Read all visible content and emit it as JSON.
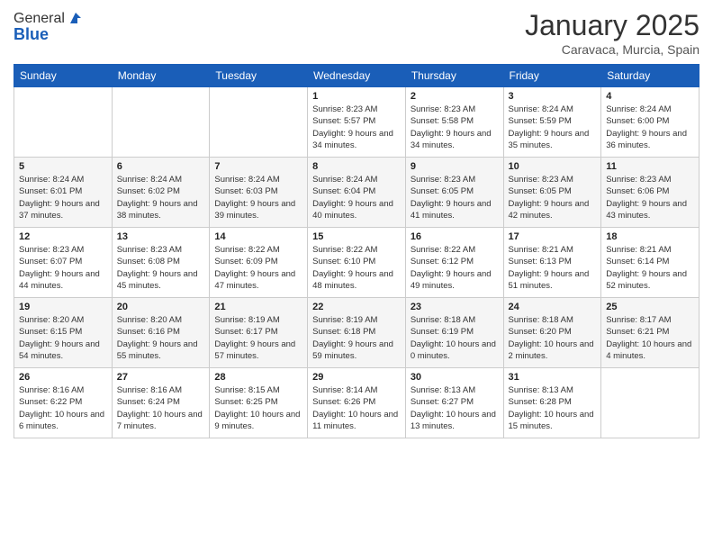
{
  "logo": {
    "general": "General",
    "blue": "Blue"
  },
  "title": "January 2025",
  "location": "Caravaca, Murcia, Spain",
  "days_of_week": [
    "Sunday",
    "Monday",
    "Tuesday",
    "Wednesday",
    "Thursday",
    "Friday",
    "Saturday"
  ],
  "weeks": [
    [
      {
        "day": "",
        "info": ""
      },
      {
        "day": "",
        "info": ""
      },
      {
        "day": "",
        "info": ""
      },
      {
        "day": "1",
        "sunrise": "Sunrise: 8:23 AM",
        "sunset": "Sunset: 5:57 PM",
        "daylight": "Daylight: 9 hours and 34 minutes."
      },
      {
        "day": "2",
        "sunrise": "Sunrise: 8:23 AM",
        "sunset": "Sunset: 5:58 PM",
        "daylight": "Daylight: 9 hours and 34 minutes."
      },
      {
        "day": "3",
        "sunrise": "Sunrise: 8:24 AM",
        "sunset": "Sunset: 5:59 PM",
        "daylight": "Daylight: 9 hours and 35 minutes."
      },
      {
        "day": "4",
        "sunrise": "Sunrise: 8:24 AM",
        "sunset": "Sunset: 6:00 PM",
        "daylight": "Daylight: 9 hours and 36 minutes."
      }
    ],
    [
      {
        "day": "5",
        "sunrise": "Sunrise: 8:24 AM",
        "sunset": "Sunset: 6:01 PM",
        "daylight": "Daylight: 9 hours and 37 minutes."
      },
      {
        "day": "6",
        "sunrise": "Sunrise: 8:24 AM",
        "sunset": "Sunset: 6:02 PM",
        "daylight": "Daylight: 9 hours and 38 minutes."
      },
      {
        "day": "7",
        "sunrise": "Sunrise: 8:24 AM",
        "sunset": "Sunset: 6:03 PM",
        "daylight": "Daylight: 9 hours and 39 minutes."
      },
      {
        "day": "8",
        "sunrise": "Sunrise: 8:24 AM",
        "sunset": "Sunset: 6:04 PM",
        "daylight": "Daylight: 9 hours and 40 minutes."
      },
      {
        "day": "9",
        "sunrise": "Sunrise: 8:23 AM",
        "sunset": "Sunset: 6:05 PM",
        "daylight": "Daylight: 9 hours and 41 minutes."
      },
      {
        "day": "10",
        "sunrise": "Sunrise: 8:23 AM",
        "sunset": "Sunset: 6:05 PM",
        "daylight": "Daylight: 9 hours and 42 minutes."
      },
      {
        "day": "11",
        "sunrise": "Sunrise: 8:23 AM",
        "sunset": "Sunset: 6:06 PM",
        "daylight": "Daylight: 9 hours and 43 minutes."
      }
    ],
    [
      {
        "day": "12",
        "sunrise": "Sunrise: 8:23 AM",
        "sunset": "Sunset: 6:07 PM",
        "daylight": "Daylight: 9 hours and 44 minutes."
      },
      {
        "day": "13",
        "sunrise": "Sunrise: 8:23 AM",
        "sunset": "Sunset: 6:08 PM",
        "daylight": "Daylight: 9 hours and 45 minutes."
      },
      {
        "day": "14",
        "sunrise": "Sunrise: 8:22 AM",
        "sunset": "Sunset: 6:09 PM",
        "daylight": "Daylight: 9 hours and 47 minutes."
      },
      {
        "day": "15",
        "sunrise": "Sunrise: 8:22 AM",
        "sunset": "Sunset: 6:10 PM",
        "daylight": "Daylight: 9 hours and 48 minutes."
      },
      {
        "day": "16",
        "sunrise": "Sunrise: 8:22 AM",
        "sunset": "Sunset: 6:12 PM",
        "daylight": "Daylight: 9 hours and 49 minutes."
      },
      {
        "day": "17",
        "sunrise": "Sunrise: 8:21 AM",
        "sunset": "Sunset: 6:13 PM",
        "daylight": "Daylight: 9 hours and 51 minutes."
      },
      {
        "day": "18",
        "sunrise": "Sunrise: 8:21 AM",
        "sunset": "Sunset: 6:14 PM",
        "daylight": "Daylight: 9 hours and 52 minutes."
      }
    ],
    [
      {
        "day": "19",
        "sunrise": "Sunrise: 8:20 AM",
        "sunset": "Sunset: 6:15 PM",
        "daylight": "Daylight: 9 hours and 54 minutes."
      },
      {
        "day": "20",
        "sunrise": "Sunrise: 8:20 AM",
        "sunset": "Sunset: 6:16 PM",
        "daylight": "Daylight: 9 hours and 55 minutes."
      },
      {
        "day": "21",
        "sunrise": "Sunrise: 8:19 AM",
        "sunset": "Sunset: 6:17 PM",
        "daylight": "Daylight: 9 hours and 57 minutes."
      },
      {
        "day": "22",
        "sunrise": "Sunrise: 8:19 AM",
        "sunset": "Sunset: 6:18 PM",
        "daylight": "Daylight: 9 hours and 59 minutes."
      },
      {
        "day": "23",
        "sunrise": "Sunrise: 8:18 AM",
        "sunset": "Sunset: 6:19 PM",
        "daylight": "Daylight: 10 hours and 0 minutes."
      },
      {
        "day": "24",
        "sunrise": "Sunrise: 8:18 AM",
        "sunset": "Sunset: 6:20 PM",
        "daylight": "Daylight: 10 hours and 2 minutes."
      },
      {
        "day": "25",
        "sunrise": "Sunrise: 8:17 AM",
        "sunset": "Sunset: 6:21 PM",
        "daylight": "Daylight: 10 hours and 4 minutes."
      }
    ],
    [
      {
        "day": "26",
        "sunrise": "Sunrise: 8:16 AM",
        "sunset": "Sunset: 6:22 PM",
        "daylight": "Daylight: 10 hours and 6 minutes."
      },
      {
        "day": "27",
        "sunrise": "Sunrise: 8:16 AM",
        "sunset": "Sunset: 6:24 PM",
        "daylight": "Daylight: 10 hours and 7 minutes."
      },
      {
        "day": "28",
        "sunrise": "Sunrise: 8:15 AM",
        "sunset": "Sunset: 6:25 PM",
        "daylight": "Daylight: 10 hours and 9 minutes."
      },
      {
        "day": "29",
        "sunrise": "Sunrise: 8:14 AM",
        "sunset": "Sunset: 6:26 PM",
        "daylight": "Daylight: 10 hours and 11 minutes."
      },
      {
        "day": "30",
        "sunrise": "Sunrise: 8:13 AM",
        "sunset": "Sunset: 6:27 PM",
        "daylight": "Daylight: 10 hours and 13 minutes."
      },
      {
        "day": "31",
        "sunrise": "Sunrise: 8:13 AM",
        "sunset": "Sunset: 6:28 PM",
        "daylight": "Daylight: 10 hours and 15 minutes."
      },
      {
        "day": "",
        "info": ""
      }
    ]
  ]
}
